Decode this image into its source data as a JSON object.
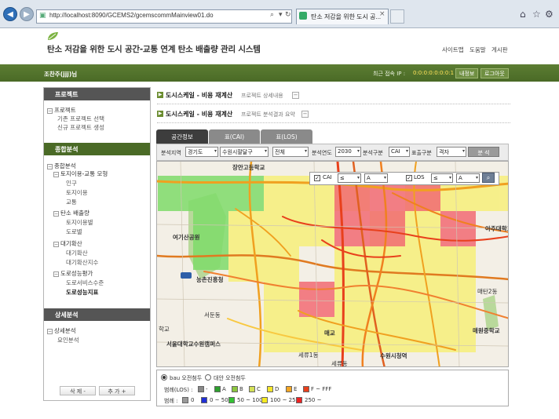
{
  "browser": {
    "url": "http://localhost:8090/GCEMS2/gcemscommMainview01.do",
    "tab_title": "탄소 저감을 위한 도시 공..."
  },
  "site": {
    "title": "탄소 저감을 위한 도시 공간-교통 연계 탄소 배출량 관리 시스템",
    "links": [
      "사이트맵",
      "도움말",
      "게시판"
    ]
  },
  "userbar": {
    "user": "조찬주(jjj)님",
    "ip_label": "최근 접속 IP :",
    "ip_value": "0:0:0:0:0:0:0:1",
    "buttons": [
      "내정보",
      "로그아웃"
    ]
  },
  "sidebar": {
    "project_head": "프로젝트",
    "project_root": "프로젝트",
    "project_items": [
      "기존 프로젝트 선택",
      "신규 프로젝트 생성"
    ],
    "analysis_head": "종합분석",
    "analysis_root": "종합분석",
    "group1": "토지이용-교통 모형",
    "group1_items": [
      "인구",
      "토지이용",
      "교통"
    ],
    "group2": "탄소 배출량",
    "group2_items": [
      "토지이용별",
      "도로별"
    ],
    "group3": "대기확산",
    "group3_items": [
      "대기확산",
      "대기확산지수"
    ],
    "group4": "도로성능평가",
    "group4_items": [
      "도로서비스수준",
      "도로성능지표"
    ],
    "detail_head": "상세분석",
    "detail_root": "상세분석",
    "detail_items": [
      "요인분석"
    ],
    "delete_btn": "삭 제 -",
    "add_btn": "추 가 +"
  },
  "sections": [
    {
      "title": "도시스케일 - 비용 재계산",
      "sub": "프로젝트 상세내용"
    },
    {
      "title": "도시스케일 - 비용 재계산",
      "sub": "프로젝트 분석결과 요약"
    }
  ],
  "tabs": [
    "공간정보",
    "표(CAI)",
    "표(LOS)"
  ],
  "filters": {
    "region_label": "분석지역",
    "region_province": "경기도",
    "region_city": "수원시팔달구",
    "region_dong": "전체",
    "year_label": "분석연도",
    "year": "2030",
    "type_label": "분석구분",
    "type": "CAI",
    "display_label": "표출구분",
    "display": "격자",
    "analyze_btn": "분 석"
  },
  "map_ctrl": {
    "cai_label": "CAI",
    "cai_op": "≤",
    "cai_val": "A",
    "los_label": "LOS",
    "los_op": "≤",
    "los_val": "A"
  },
  "map_labels": [
    "장안고등학교",
    "여기산공원",
    "농촌진흥청",
    "서둔동",
    "학교",
    "서울대학교수원캠퍼스",
    "매교",
    "세류1동",
    "세류동",
    "수원시청역",
    "아주대학교",
    "매원중학교",
    "매탄2동"
  ],
  "legend": {
    "radio1": "bau 오전첨두",
    "radio2": "대안 오전첨두",
    "los_label": "범례(LOS) :",
    "los_items": [
      {
        "label": "-",
        "color": "#888888"
      },
      {
        "label": "A",
        "color": "#2ea02e"
      },
      {
        "label": "B",
        "color": "#8cc63f"
      },
      {
        "label": "C",
        "color": "#d4e157"
      },
      {
        "label": "D",
        "color": "#f5e62a"
      },
      {
        "label": "E",
        "color": "#f5a623"
      },
      {
        "label": "F ~ FFF",
        "color": "#e8401c"
      }
    ],
    "cai_label": "범례 :",
    "cai_items": [
      {
        "label": "0",
        "color": "#999999"
      },
      {
        "label": "0 ~ 50",
        "color": "#1f2fd6"
      },
      {
        "label": "50 ~ 100",
        "color": "#34c234"
      },
      {
        "label": "100 ~ 250",
        "color": "#f5ea22"
      },
      {
        "label": "250 ~",
        "color": "#ee2222"
      }
    ]
  },
  "colors": {
    "brand_green": "#4a6a26",
    "grid_red": "#f26b73",
    "grid_yellow": "#f7ef7a",
    "grid_green": "#7fdc6a"
  }
}
